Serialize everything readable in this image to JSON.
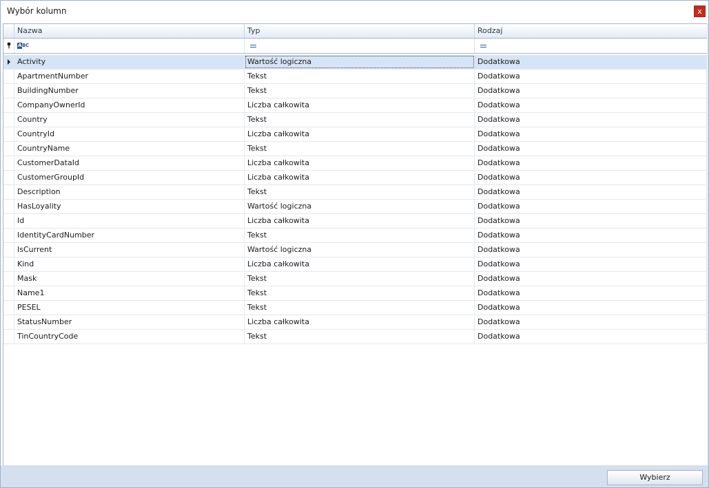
{
  "window": {
    "title": "Wybór kolumn",
    "close_label": "x"
  },
  "grid": {
    "columns": [
      "Nazwa",
      "Typ",
      "Rodzaj"
    ],
    "filter_icons": [
      "abc-filter-icon",
      "equals-filter-icon",
      "equals-filter-icon"
    ],
    "rows": [
      {
        "name": "Activity",
        "type": "Wartość logiczna",
        "kind": "Dodatkowa"
      },
      {
        "name": "ApartmentNumber",
        "type": "Tekst",
        "kind": "Dodatkowa"
      },
      {
        "name": "BuildingNumber",
        "type": "Tekst",
        "kind": "Dodatkowa"
      },
      {
        "name": "CompanyOwnerId",
        "type": "Liczba całkowita",
        "kind": "Dodatkowa"
      },
      {
        "name": "Country",
        "type": "Tekst",
        "kind": "Dodatkowa"
      },
      {
        "name": "CountryId",
        "type": "Liczba całkowita",
        "kind": "Dodatkowa"
      },
      {
        "name": "CountryName",
        "type": "Tekst",
        "kind": "Dodatkowa"
      },
      {
        "name": "CustomerDataId",
        "type": "Liczba całkowita",
        "kind": "Dodatkowa"
      },
      {
        "name": "CustomerGroupId",
        "type": "Liczba całkowita",
        "kind": "Dodatkowa"
      },
      {
        "name": "Description",
        "type": "Tekst",
        "kind": "Dodatkowa"
      },
      {
        "name": "HasLoyality",
        "type": "Wartość logiczna",
        "kind": "Dodatkowa"
      },
      {
        "name": "Id",
        "type": "Liczba całkowita",
        "kind": "Dodatkowa"
      },
      {
        "name": "IdentityCardNumber",
        "type": "Tekst",
        "kind": "Dodatkowa"
      },
      {
        "name": "IsCurrent",
        "type": "Wartość logiczna",
        "kind": "Dodatkowa"
      },
      {
        "name": "Kind",
        "type": "Liczba całkowita",
        "kind": "Dodatkowa"
      },
      {
        "name": "Mask",
        "type": "Tekst",
        "kind": "Dodatkowa"
      },
      {
        "name": "Name1",
        "type": "Tekst",
        "kind": "Dodatkowa"
      },
      {
        "name": "PESEL",
        "type": "Tekst",
        "kind": "Dodatkowa"
      },
      {
        "name": "StatusNumber",
        "type": "Liczba całkowita",
        "kind": "Dodatkowa"
      },
      {
        "name": "TinCountryCode",
        "type": "Tekst",
        "kind": "Dodatkowa"
      }
    ],
    "selected_row": 0
  },
  "footer": {
    "select_label": "Wybierz"
  },
  "colors": {
    "selected_row": "#d6e4f7",
    "footer_bg": "#d4e0ee",
    "close_button": "#c42b1c"
  }
}
